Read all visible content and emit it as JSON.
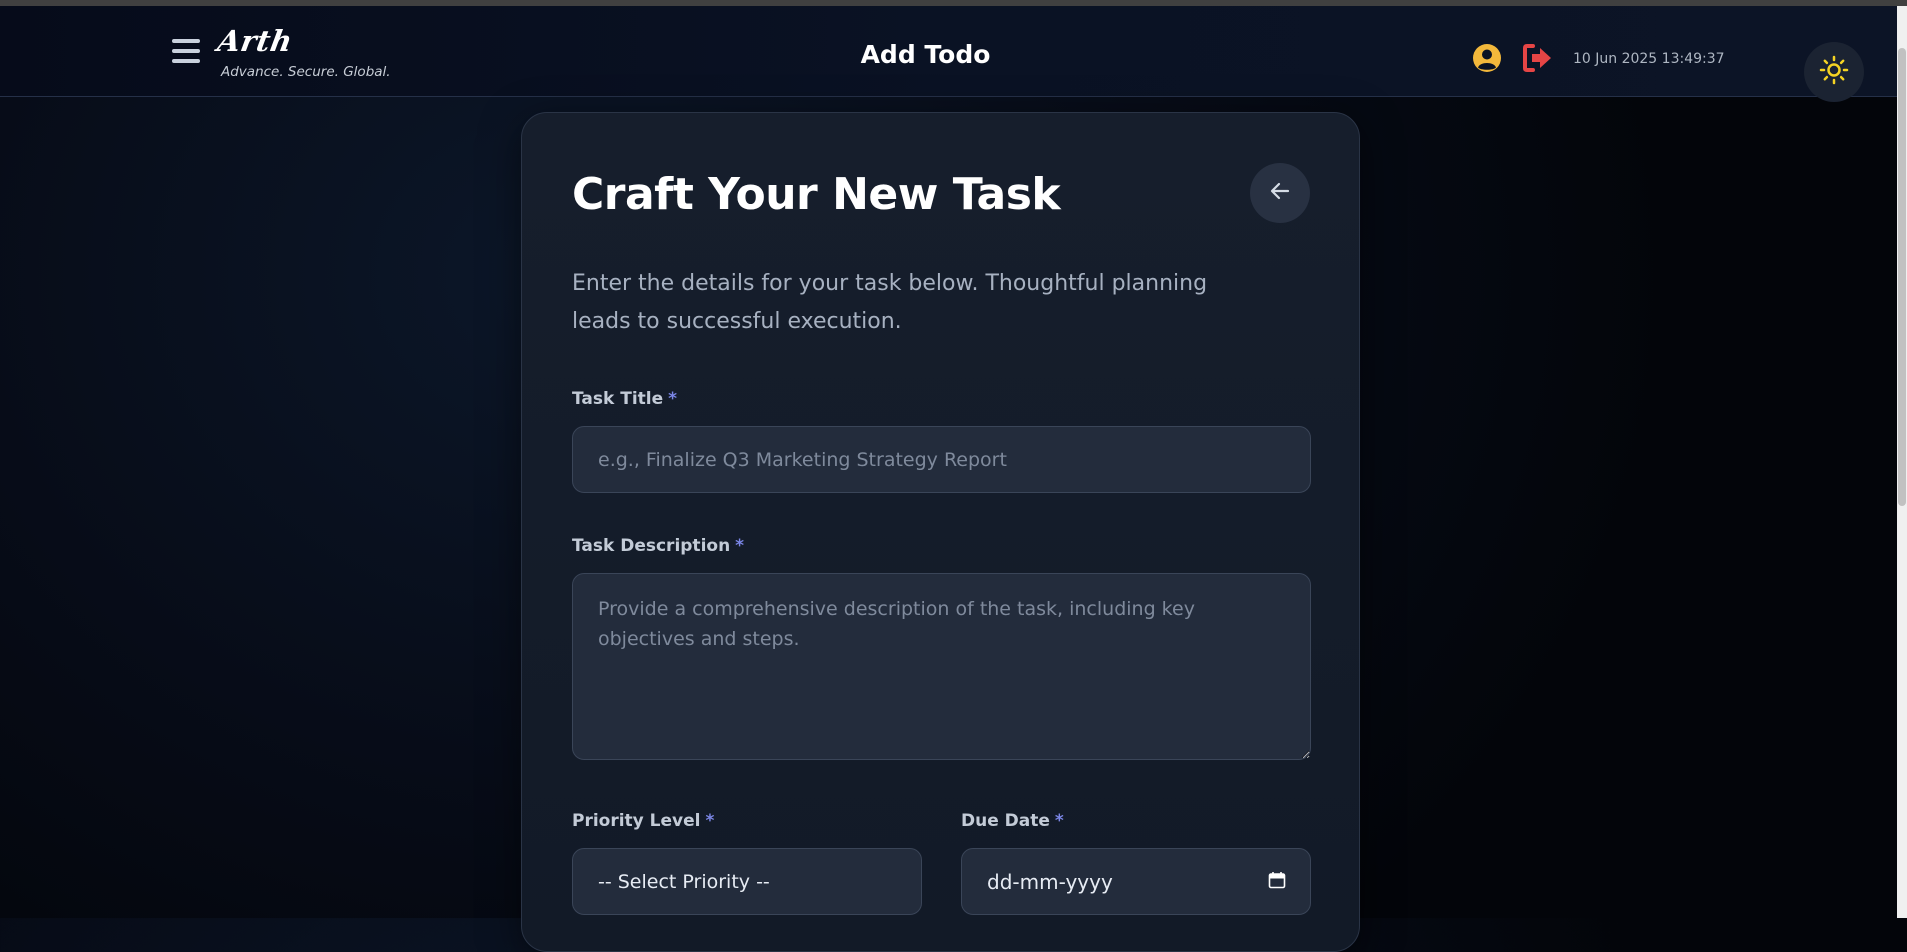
{
  "header": {
    "brand_name": "Arth",
    "tagline": "Advance. Secure. Global.",
    "title": "Add Todo",
    "datetime": "10 Jun 2025 13:49:37",
    "icons": {
      "menu": "hamburger-menu-icon",
      "user": "user-circle-icon",
      "logout": "logout-icon",
      "theme": "sun-icon"
    },
    "colors": {
      "user_icon": "#f3b83b",
      "logout_icon": "#e64545",
      "theme_icon": "#f5d323"
    }
  },
  "card": {
    "title": "Craft Your New Task",
    "subtitle": "Enter the details for your task below. Thoughtful planning leads to successful execution.",
    "back_icon": "arrow-left-icon"
  },
  "form": {
    "required_marker": "*",
    "task_title": {
      "label": "Task Title",
      "placeholder": "e.g., Finalize Q3 Marketing Strategy Report",
      "value": ""
    },
    "task_description": {
      "label": "Task Description",
      "placeholder": "Provide a comprehensive description of the task, including key objectives and steps.",
      "value": ""
    },
    "priority": {
      "label": "Priority Level",
      "selected": "-- Select Priority --"
    },
    "due_date": {
      "label": "Due Date",
      "value": "dd-mm-yyyy",
      "icon": "calendar-icon"
    }
  },
  "accent_color": "#7b86e6"
}
